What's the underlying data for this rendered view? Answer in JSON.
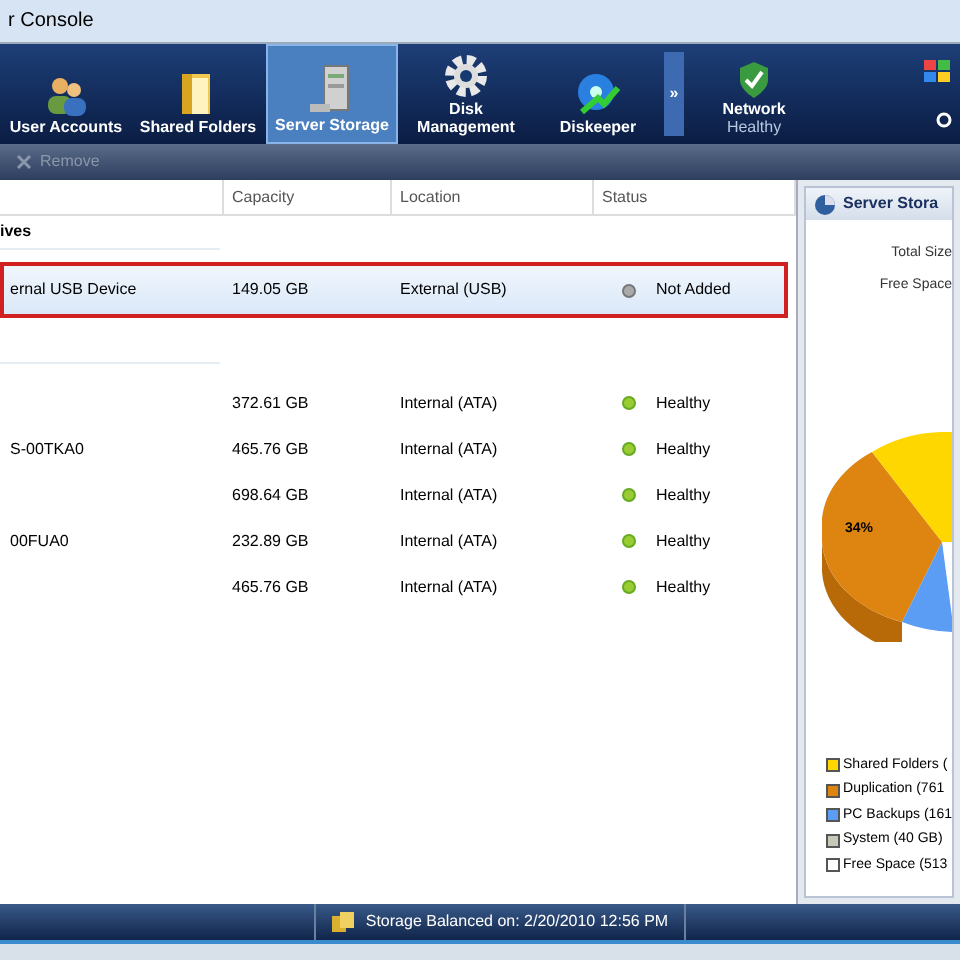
{
  "window": {
    "title": "r Console"
  },
  "nav": [
    {
      "label": "User Accounts",
      "selected": false
    },
    {
      "label": "Shared Folders",
      "selected": false
    },
    {
      "label": "Server Storage",
      "selected": true
    },
    {
      "label": "Disk Management",
      "selected": false
    },
    {
      "label": "Diskeeper",
      "selected": false
    }
  ],
  "more": "»",
  "network": {
    "label": "Network",
    "status": "Healthy"
  },
  "toolbar": [
    {
      "label": "Remove",
      "disabled": true
    }
  ],
  "table": {
    "columns": [
      "",
      "Capacity",
      "Location",
      "Status"
    ],
    "groups": [
      {
        "title": "ives",
        "rows": [
          {
            "name": "ernal USB Device",
            "capacity": "149.05 GB",
            "location": "External (USB)",
            "status": "Not Added",
            "healthy": false,
            "selected": true
          }
        ]
      },
      {
        "rows": [
          {
            "name": "",
            "capacity": "372.61 GB",
            "location": "Internal (ATA)",
            "status": "Healthy",
            "healthy": true,
            "selected": false
          },
          {
            "name": "S-00TKA0",
            "capacity": "465.76 GB",
            "location": "Internal (ATA)",
            "status": "Healthy",
            "healthy": true,
            "selected": false
          },
          {
            "name": "",
            "capacity": "698.64 GB",
            "location": "Internal (ATA)",
            "status": "Healthy",
            "healthy": true,
            "selected": false
          },
          {
            "name": "00FUA0",
            "capacity": "232.89 GB",
            "location": "Internal (ATA)",
            "status": "Healthy",
            "healthy": true,
            "selected": false
          },
          {
            "name": "",
            "capacity": "465.76 GB",
            "location": "Internal (ATA)",
            "status": "Healthy",
            "healthy": true,
            "selected": false
          }
        ]
      }
    ]
  },
  "panel": {
    "title": "Server Stora",
    "stats": [
      "Total Size",
      "Free Space"
    ],
    "pie_label": "34%",
    "legend": [
      {
        "label": "Shared Folders (",
        "color": "#ffd700"
      },
      {
        "label": "Duplication (761",
        "color": "#de8410"
      },
      {
        "label": "PC Backups (161",
        "color": "#5b9cf5"
      },
      {
        "label": "System (40 GB)",
        "color": "#c8c8b8"
      },
      {
        "label": "Free Space (513",
        "color": "#ffffff"
      }
    ]
  },
  "status_bar": "Storage Balanced on: 2/20/2010 12:56 PM"
}
